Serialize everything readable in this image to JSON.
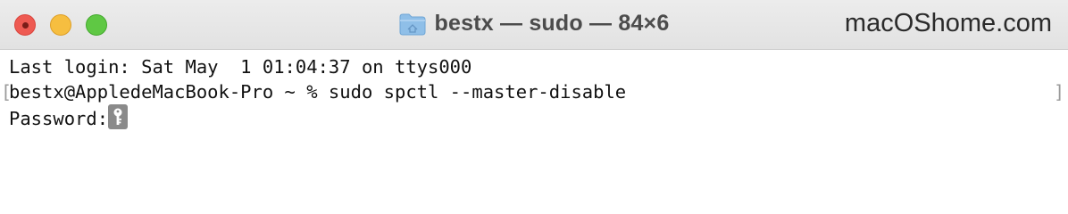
{
  "window": {
    "title": "bestx — sudo — 84×6",
    "watermark": "macOShome.com"
  },
  "titlebar": {
    "folder_icon": "folder-icon",
    "buttons": [
      "close",
      "minimize",
      "zoom"
    ]
  },
  "terminal": {
    "lines": [
      "Last login: Sat May  1 01:04:37 on ttys000",
      "bestx@AppledeMacBook-Pro ~ % sudo spctl --master-disable",
      "Password:"
    ],
    "cursor_icon": "key-icon"
  },
  "colors": {
    "close": "#ee5a52",
    "minimize": "#f6be40",
    "zoom": "#5fc844",
    "folder": "#8fbfe8",
    "cursor": "#8a8a8a"
  }
}
